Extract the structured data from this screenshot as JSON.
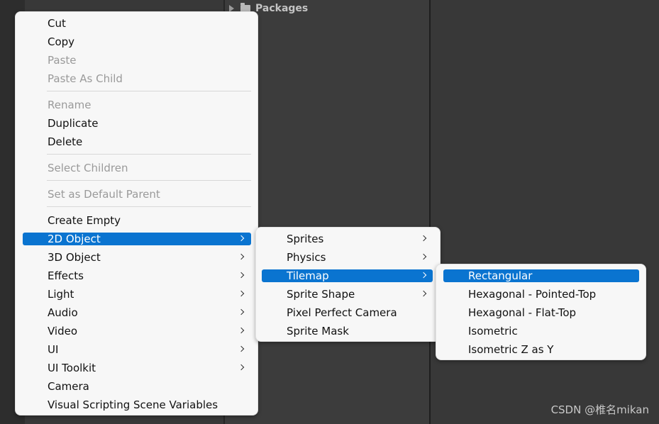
{
  "background": {
    "project_folder": "Packages"
  },
  "watermark": "CSDN @椎名mikan",
  "main_menu": {
    "items": [
      {
        "label": "Cut",
        "enabled": true
      },
      {
        "label": "Copy",
        "enabled": true
      },
      {
        "label": "Paste",
        "enabled": false
      },
      {
        "label": "Paste As Child",
        "enabled": false
      },
      {
        "label": "Rename",
        "enabled": false
      },
      {
        "label": "Duplicate",
        "enabled": true
      },
      {
        "label": "Delete",
        "enabled": true
      },
      {
        "label": "Select Children",
        "enabled": false
      },
      {
        "label": "Set as Default Parent",
        "enabled": false
      },
      {
        "label": "Create Empty",
        "enabled": true
      },
      {
        "label": "2D Object",
        "enabled": true,
        "submenu": true,
        "highlighted": true
      },
      {
        "label": "3D Object",
        "enabled": true,
        "submenu": true
      },
      {
        "label": "Effects",
        "enabled": true,
        "submenu": true
      },
      {
        "label": "Light",
        "enabled": true,
        "submenu": true
      },
      {
        "label": "Audio",
        "enabled": true,
        "submenu": true
      },
      {
        "label": "Video",
        "enabled": true,
        "submenu": true
      },
      {
        "label": "UI",
        "enabled": true,
        "submenu": true
      },
      {
        "label": "UI Toolkit",
        "enabled": true,
        "submenu": true
      },
      {
        "label": "Camera",
        "enabled": true
      },
      {
        "label": "Visual Scripting Scene Variables",
        "enabled": true
      }
    ]
  },
  "object2d_menu": {
    "items": [
      {
        "label": "Sprites",
        "submenu": true
      },
      {
        "label": "Physics",
        "submenu": true
      },
      {
        "label": "Tilemap",
        "submenu": true,
        "highlighted": true
      },
      {
        "label": "Sprite Shape",
        "submenu": true
      },
      {
        "label": "Pixel Perfect Camera",
        "submenu": false
      },
      {
        "label": "Sprite Mask",
        "submenu": false
      }
    ]
  },
  "tilemap_menu": {
    "items": [
      {
        "label": "Rectangular",
        "highlighted": true
      },
      {
        "label": "Hexagonal - Pointed-Top"
      },
      {
        "label": "Hexagonal - Flat-Top"
      },
      {
        "label": "Isometric"
      },
      {
        "label": "Isometric Z as Y"
      }
    ]
  },
  "colors": {
    "highlight": "#0a74d0",
    "menu_bg": "#f7f7f7",
    "disabled_text": "#9a9a9a"
  }
}
